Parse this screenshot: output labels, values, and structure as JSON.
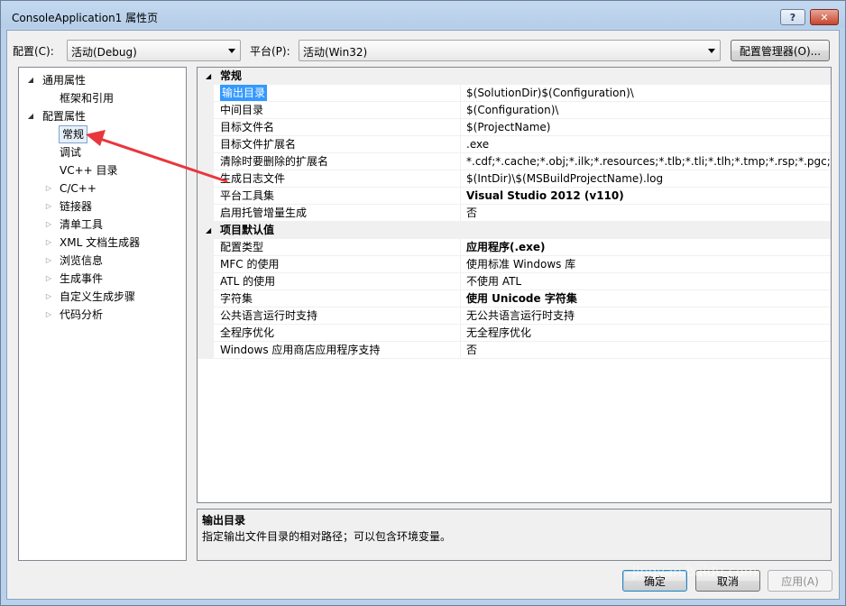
{
  "window": {
    "title": "ConsoleApplication1 属性页",
    "help_label": "?",
    "close_label": "✕"
  },
  "toolbar": {
    "config_label": "配置(C):",
    "config_value": "活动(Debug)",
    "platform_label": "平台(P):",
    "platform_value": "活动(Win32)",
    "config_manager_label": "配置管理器(O)..."
  },
  "tree": {
    "items": [
      {
        "label": "通用属性",
        "level": 0,
        "expander": "◢"
      },
      {
        "label": "框架和引用",
        "level": 1,
        "expander": ""
      },
      {
        "label": "配置属性",
        "level": 0,
        "expander": "◢"
      },
      {
        "label": "常规",
        "level": 1,
        "expander": "",
        "selected": true
      },
      {
        "label": "调试",
        "level": 1,
        "expander": ""
      },
      {
        "label": "VC++ 目录",
        "level": 1,
        "expander": ""
      },
      {
        "label": "C/C++",
        "level": 1,
        "expander": "▷"
      },
      {
        "label": "链接器",
        "level": 1,
        "expander": "▷"
      },
      {
        "label": "清单工具",
        "level": 1,
        "expander": "▷"
      },
      {
        "label": "XML 文档生成器",
        "level": 1,
        "expander": "▷"
      },
      {
        "label": "浏览信息",
        "level": 1,
        "expander": "▷"
      },
      {
        "label": "生成事件",
        "level": 1,
        "expander": "▷"
      },
      {
        "label": "自定义生成步骤",
        "level": 1,
        "expander": "▷"
      },
      {
        "label": "代码分析",
        "level": 1,
        "expander": "▷"
      }
    ]
  },
  "grid": {
    "sections": [
      {
        "title": "常规",
        "expander": "◢",
        "rows": [
          {
            "name": "输出目录",
            "value": "$(SolutionDir)$(Configuration)\\",
            "selected": true
          },
          {
            "name": "中间目录",
            "value": "$(Configuration)\\"
          },
          {
            "name": "目标文件名",
            "value": "$(ProjectName)"
          },
          {
            "name": "目标文件扩展名",
            "value": ".exe"
          },
          {
            "name": "清除时要删除的扩展名",
            "value": "*.cdf;*.cache;*.obj;*.ilk;*.resources;*.tlb;*.tli;*.tlh;*.tmp;*.rsp;*.pgc;*.pgd;*"
          },
          {
            "name": "生成日志文件",
            "value": "$(IntDir)\\$(MSBuildProjectName).log"
          },
          {
            "name": "平台工具集",
            "value": "Visual Studio 2012 (v110)",
            "bold": true
          },
          {
            "name": "启用托管增量生成",
            "value": "否"
          }
        ]
      },
      {
        "title": "项目默认值",
        "expander": "◢",
        "rows": [
          {
            "name": "配置类型",
            "value": "应用程序(.exe)",
            "bold": true
          },
          {
            "name": "MFC 的使用",
            "value": "使用标准 Windows 库"
          },
          {
            "name": "ATL 的使用",
            "value": "不使用 ATL"
          },
          {
            "name": "字符集",
            "value": "使用 Unicode 字符集",
            "bold": true
          },
          {
            "name": "公共语言运行时支持",
            "value": "无公共语言运行时支持"
          },
          {
            "name": "全程序优化",
            "value": "无全程序优化"
          },
          {
            "name": "Windows 应用商店应用程序支持",
            "value": "否"
          }
        ]
      }
    ]
  },
  "description": {
    "title": "输出目录",
    "text": "指定输出文件目录的相对路径；可以包含环境变量。"
  },
  "buttons": {
    "ok_label": "确定",
    "cancel_label": "取消",
    "apply_label": "应用(A)"
  },
  "watermark": "jingyan.baidu.com",
  "colors": {
    "annotation_arrow": "#e8373c",
    "selection": "#3399ff"
  }
}
